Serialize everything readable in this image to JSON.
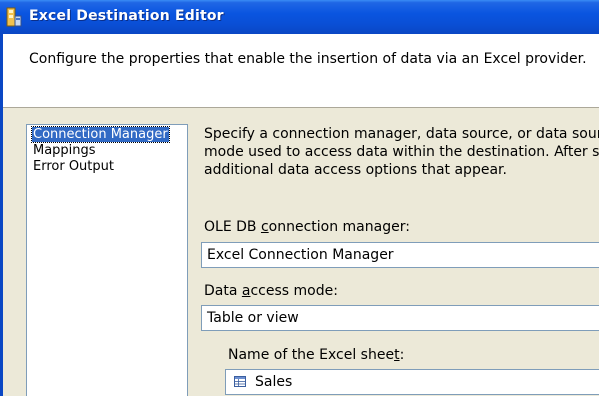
{
  "window": {
    "title": "Excel Destination Editor",
    "icon": "ssis-package-icon"
  },
  "header": {
    "description": "Configure the properties that enable the insertion of data via an Excel provider."
  },
  "nav": {
    "items": [
      {
        "label": "Connection Manager",
        "selected": true
      },
      {
        "label": "Mappings",
        "selected": false
      },
      {
        "label": "Error Output",
        "selected": false
      }
    ]
  },
  "main": {
    "description_lines": [
      "Specify a connection manager, data source, or data source v",
      "mode used to access data within the destination. After select",
      "additional data access options that appear."
    ],
    "connection_manager": {
      "label_pre": "OLE DB ",
      "label_accel": "c",
      "label_post": "onnection manager:",
      "value": "Excel Connection Manager"
    },
    "access_mode": {
      "label_pre": "Data ",
      "label_accel": "a",
      "label_post": "ccess mode:",
      "value": "Table or view"
    },
    "sheet": {
      "label_pre": "Name of the Excel shee",
      "label_accel": "t",
      "label_post": ":",
      "value": "Sales",
      "icon": "table-icon"
    }
  },
  "colors": {
    "titlebar": "#0a4fd6",
    "selection": "#316ac5",
    "window_bg": "#ece9d8"
  }
}
